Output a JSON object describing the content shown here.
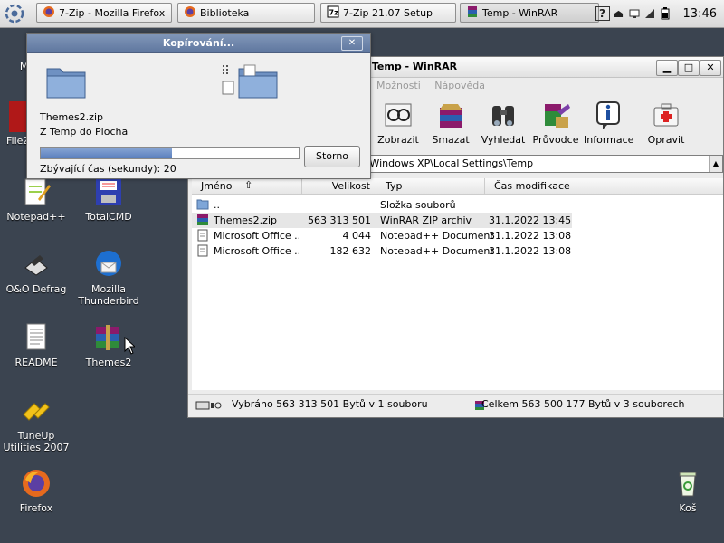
{
  "taskbar": {
    "tasks": [
      {
        "label": "7-Zip - Mozilla Firefox",
        "icon": "firefox-icon"
      },
      {
        "label": "Biblioteka",
        "icon": "firefox-icon"
      },
      {
        "label": "7-Zip 21.07 Setup",
        "icon": "7zip-icon"
      },
      {
        "label": "Temp - WinRAR",
        "icon": "winrar-icon"
      }
    ],
    "clock": "13:46"
  },
  "desktop": {
    "icons": [
      {
        "label": "Me",
        "icon": "computer-icon"
      },
      {
        "label": "FileZ",
        "icon": "filezilla-icon"
      },
      {
        "label": "Notepad++",
        "icon": "notepadpp-icon"
      },
      {
        "label": "TotalCMD",
        "icon": "floppy-icon"
      },
      {
        "label": "O&O Defrag",
        "icon": "defrag-icon"
      },
      {
        "label": "Mozilla Thunderbird",
        "icon": "thunderbird-icon"
      },
      {
        "label": "README",
        "icon": "text-file-icon"
      },
      {
        "label": "Themes2",
        "icon": "winrar-archive-icon"
      },
      {
        "label": "TuneUp Utilities 2007",
        "icon": "tuneup-icon"
      },
      {
        "label": "Firefox",
        "icon": "firefox-icon"
      },
      {
        "label": "Koš",
        "icon": "recycle-bin-icon"
      }
    ]
  },
  "winrar": {
    "title": "Temp - WinRAR",
    "menu": [
      "Možnosti",
      "Nápověda"
    ],
    "toolbar": [
      {
        "label": "Zobrazit",
        "icon": "view-icon"
      },
      {
        "label": "Smazat",
        "icon": "delete-icon"
      },
      {
        "label": "Vyhledat",
        "icon": "find-icon"
      },
      {
        "label": "Průvodce",
        "icon": "wizard-icon"
      },
      {
        "label": "Informace",
        "icon": "info-icon"
      },
      {
        "label": "Opravit",
        "icon": "repair-icon"
      }
    ],
    "address": "s\\Windows XP\\Local Settings\\Temp",
    "columns": {
      "name": "Jméno",
      "size": "Velikost",
      "type": "Typ",
      "modified": "Čas modifikace"
    },
    "rows": [
      {
        "name": "..",
        "size": "",
        "type": "Složka souborů",
        "modified": "",
        "icon": "folder-icon"
      },
      {
        "name": "Themes2.zip",
        "size": "563 313 501",
        "type": "WinRAR ZIP archiv",
        "modified": "31.1.2022 13:45",
        "icon": "winrar-archive-icon"
      },
      {
        "name": "Microsoft Office ...",
        "size": "4 044",
        "type": "Notepad++ Document",
        "modified": "31.1.2022 13:08",
        "icon": "document-icon"
      },
      {
        "name": "Microsoft Office ...",
        "size": "182 632",
        "type": "Notepad++ Document",
        "modified": "31.1.2022 13:08",
        "icon": "document-icon"
      }
    ],
    "status": {
      "selected": "Vybráno 563 313 501 Bytů v 1 souboru",
      "total": "Celkem 563 500 177 Bytů v 3 souborech"
    }
  },
  "copy_dialog": {
    "title": "Kopírování...",
    "file": "Themes2.zip",
    "path": "Z Temp do Plocha",
    "progress": 0.51,
    "remaining": "Zbývající čas (sekundy): 20",
    "cancel_label": "Storno"
  }
}
